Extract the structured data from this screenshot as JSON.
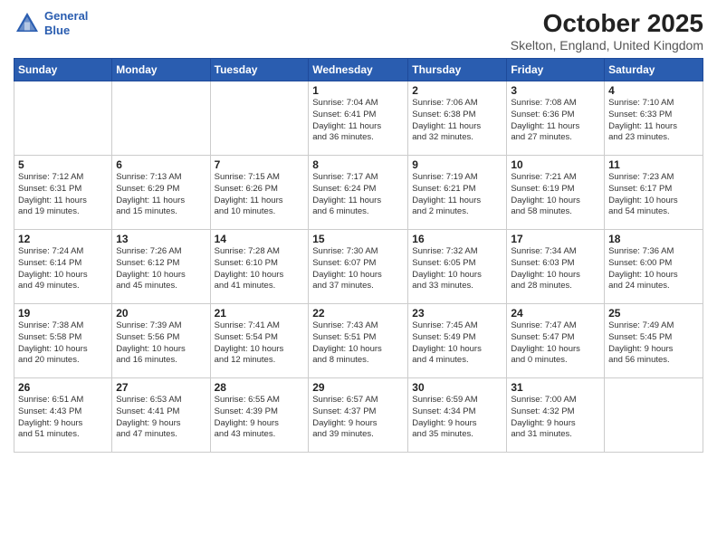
{
  "header": {
    "logo_line1": "General",
    "logo_line2": "Blue",
    "month_title": "October 2025",
    "location": "Skelton, England, United Kingdom"
  },
  "weekdays": [
    "Sunday",
    "Monday",
    "Tuesday",
    "Wednesday",
    "Thursday",
    "Friday",
    "Saturday"
  ],
  "weeks": [
    [
      {
        "day": "",
        "info": ""
      },
      {
        "day": "",
        "info": ""
      },
      {
        "day": "",
        "info": ""
      },
      {
        "day": "1",
        "info": "Sunrise: 7:04 AM\nSunset: 6:41 PM\nDaylight: 11 hours\nand 36 minutes."
      },
      {
        "day": "2",
        "info": "Sunrise: 7:06 AM\nSunset: 6:38 PM\nDaylight: 11 hours\nand 32 minutes."
      },
      {
        "day": "3",
        "info": "Sunrise: 7:08 AM\nSunset: 6:36 PM\nDaylight: 11 hours\nand 27 minutes."
      },
      {
        "day": "4",
        "info": "Sunrise: 7:10 AM\nSunset: 6:33 PM\nDaylight: 11 hours\nand 23 minutes."
      }
    ],
    [
      {
        "day": "5",
        "info": "Sunrise: 7:12 AM\nSunset: 6:31 PM\nDaylight: 11 hours\nand 19 minutes."
      },
      {
        "day": "6",
        "info": "Sunrise: 7:13 AM\nSunset: 6:29 PM\nDaylight: 11 hours\nand 15 minutes."
      },
      {
        "day": "7",
        "info": "Sunrise: 7:15 AM\nSunset: 6:26 PM\nDaylight: 11 hours\nand 10 minutes."
      },
      {
        "day": "8",
        "info": "Sunrise: 7:17 AM\nSunset: 6:24 PM\nDaylight: 11 hours\nand 6 minutes."
      },
      {
        "day": "9",
        "info": "Sunrise: 7:19 AM\nSunset: 6:21 PM\nDaylight: 11 hours\nand 2 minutes."
      },
      {
        "day": "10",
        "info": "Sunrise: 7:21 AM\nSunset: 6:19 PM\nDaylight: 10 hours\nand 58 minutes."
      },
      {
        "day": "11",
        "info": "Sunrise: 7:23 AM\nSunset: 6:17 PM\nDaylight: 10 hours\nand 54 minutes."
      }
    ],
    [
      {
        "day": "12",
        "info": "Sunrise: 7:24 AM\nSunset: 6:14 PM\nDaylight: 10 hours\nand 49 minutes."
      },
      {
        "day": "13",
        "info": "Sunrise: 7:26 AM\nSunset: 6:12 PM\nDaylight: 10 hours\nand 45 minutes."
      },
      {
        "day": "14",
        "info": "Sunrise: 7:28 AM\nSunset: 6:10 PM\nDaylight: 10 hours\nand 41 minutes."
      },
      {
        "day": "15",
        "info": "Sunrise: 7:30 AM\nSunset: 6:07 PM\nDaylight: 10 hours\nand 37 minutes."
      },
      {
        "day": "16",
        "info": "Sunrise: 7:32 AM\nSunset: 6:05 PM\nDaylight: 10 hours\nand 33 minutes."
      },
      {
        "day": "17",
        "info": "Sunrise: 7:34 AM\nSunset: 6:03 PM\nDaylight: 10 hours\nand 28 minutes."
      },
      {
        "day": "18",
        "info": "Sunrise: 7:36 AM\nSunset: 6:00 PM\nDaylight: 10 hours\nand 24 minutes."
      }
    ],
    [
      {
        "day": "19",
        "info": "Sunrise: 7:38 AM\nSunset: 5:58 PM\nDaylight: 10 hours\nand 20 minutes."
      },
      {
        "day": "20",
        "info": "Sunrise: 7:39 AM\nSunset: 5:56 PM\nDaylight: 10 hours\nand 16 minutes."
      },
      {
        "day": "21",
        "info": "Sunrise: 7:41 AM\nSunset: 5:54 PM\nDaylight: 10 hours\nand 12 minutes."
      },
      {
        "day": "22",
        "info": "Sunrise: 7:43 AM\nSunset: 5:51 PM\nDaylight: 10 hours\nand 8 minutes."
      },
      {
        "day": "23",
        "info": "Sunrise: 7:45 AM\nSunset: 5:49 PM\nDaylight: 10 hours\nand 4 minutes."
      },
      {
        "day": "24",
        "info": "Sunrise: 7:47 AM\nSunset: 5:47 PM\nDaylight: 10 hours\nand 0 minutes."
      },
      {
        "day": "25",
        "info": "Sunrise: 7:49 AM\nSunset: 5:45 PM\nDaylight: 9 hours\nand 56 minutes."
      }
    ],
    [
      {
        "day": "26",
        "info": "Sunrise: 6:51 AM\nSunset: 4:43 PM\nDaylight: 9 hours\nand 51 minutes."
      },
      {
        "day": "27",
        "info": "Sunrise: 6:53 AM\nSunset: 4:41 PM\nDaylight: 9 hours\nand 47 minutes."
      },
      {
        "day": "28",
        "info": "Sunrise: 6:55 AM\nSunset: 4:39 PM\nDaylight: 9 hours\nand 43 minutes."
      },
      {
        "day": "29",
        "info": "Sunrise: 6:57 AM\nSunset: 4:37 PM\nDaylight: 9 hours\nand 39 minutes."
      },
      {
        "day": "30",
        "info": "Sunrise: 6:59 AM\nSunset: 4:34 PM\nDaylight: 9 hours\nand 35 minutes."
      },
      {
        "day": "31",
        "info": "Sunrise: 7:00 AM\nSunset: 4:32 PM\nDaylight: 9 hours\nand 31 minutes."
      },
      {
        "day": "",
        "info": ""
      }
    ]
  ]
}
